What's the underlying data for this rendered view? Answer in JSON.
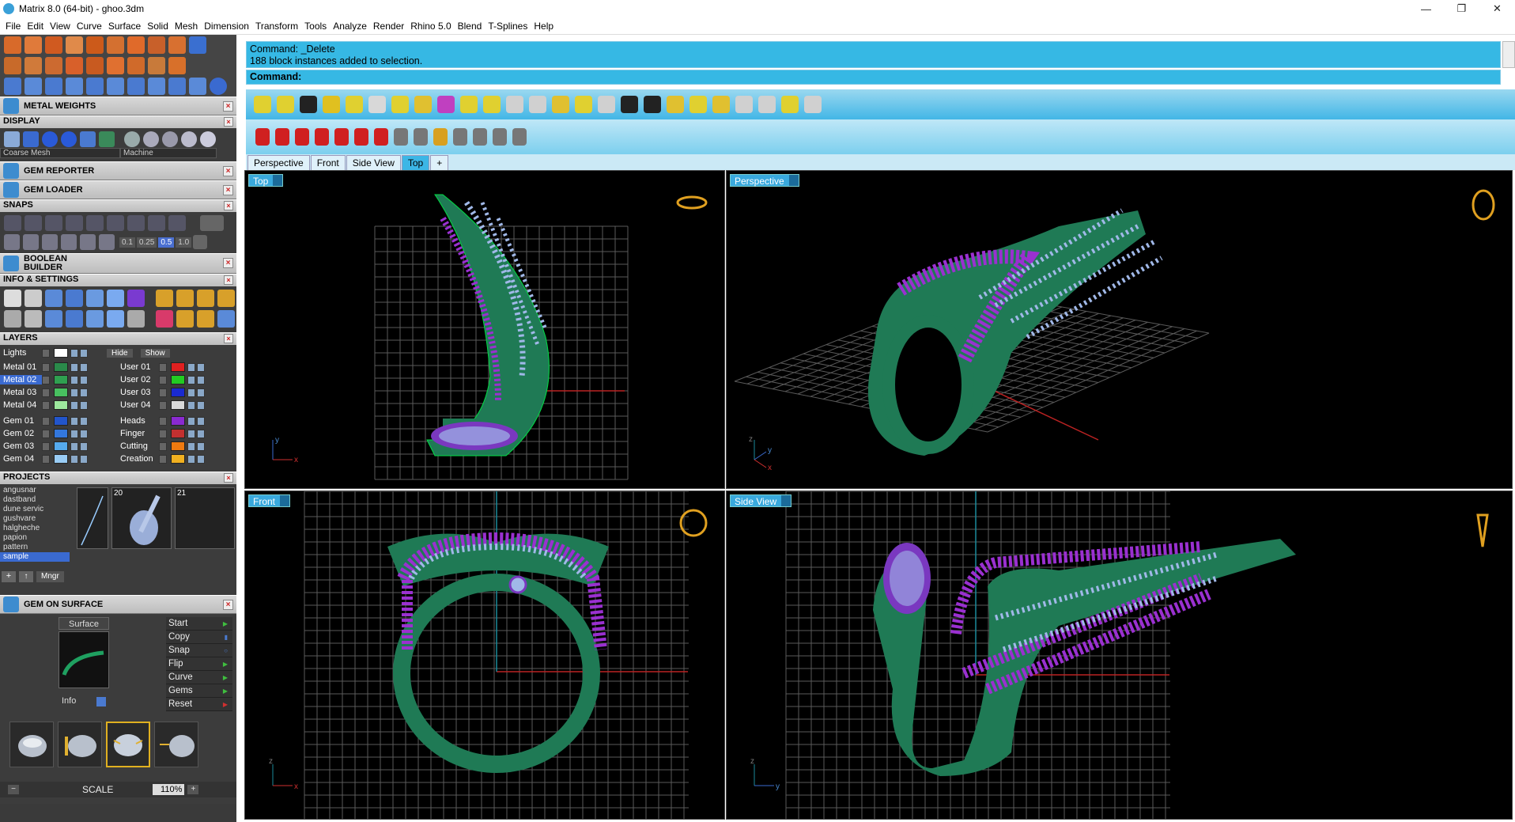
{
  "window": {
    "title": "Matrix 8.0 (64-bit) - ghoo.3dm",
    "buttons": [
      "—",
      "❐",
      "✕"
    ]
  },
  "menu": [
    "File",
    "Edit",
    "View",
    "Curve",
    "Surface",
    "Solid",
    "Mesh",
    "Dimension",
    "Transform",
    "Tools",
    "Analyze",
    "Render",
    "Rhino 5.0",
    "Blend",
    "T-Splines",
    "Help"
  ],
  "command": {
    "history_line1": "Command: _Delete",
    "history_line2": "188 block instances added to selection.",
    "prompt": "Command:"
  },
  "sidebar": {
    "metal_weights": "METAL WEIGHTS",
    "display": "DISPLAY",
    "display_mesh": "Coarse Mesh",
    "display_mode": "Machine",
    "gem_reporter": "GEM REPORTER",
    "gem_loader": "GEM LOADER",
    "snaps": "SNAPS",
    "snap_values": [
      "0.1",
      "0.25",
      "0.5",
      "1.0"
    ],
    "boolean_line1": "BOOLEAN",
    "boolean_line2": "BUILDER",
    "info_settings": "INFO & SETTINGS",
    "layers": "LAYERS",
    "layers_lights": "Lights",
    "layers_hide": "Hide",
    "layers_show": "Show",
    "layers_left": [
      {
        "name": "Metal 01",
        "color": "#2a8a4a"
      },
      {
        "name": "Metal 02",
        "color": "#2fa050"
      },
      {
        "name": "Metal 03",
        "color": "#48c060"
      },
      {
        "name": "Metal 04",
        "color": "#9de89d"
      },
      {
        "name": "Gem 01",
        "color": "#2255cc"
      },
      {
        "name": "Gem 02",
        "color": "#3377dd"
      },
      {
        "name": "Gem 03",
        "color": "#55aaee"
      },
      {
        "name": "Gem 04",
        "color": "#99ccf5"
      }
    ],
    "layers_right": [
      {
        "name": "User 01",
        "color": "#e02020"
      },
      {
        "name": "User 02",
        "color": "#22cc22"
      },
      {
        "name": "User 03",
        "color": "#1a2ad0"
      },
      {
        "name": "User 04",
        "color": "#d8d8d8"
      },
      {
        "name": "Heads",
        "color": "#8a2ad0"
      },
      {
        "name": "Finger",
        "color": "#c23030"
      },
      {
        "name": "Cutting",
        "color": "#ee7a10"
      },
      {
        "name": "Creation",
        "color": "#f0b020"
      }
    ],
    "projects": "PROJECTS",
    "project_list": [
      "angusnar",
      "dastband",
      "dune servic",
      "gushvare",
      "halgheche",
      "papion",
      "pattern",
      "sample"
    ],
    "project_thumb_numbers": [
      "20",
      "21"
    ],
    "projects_mngr": "Mngr",
    "gem_on_surface": "GEM ON SURFACE",
    "gos_surface_label": "Surface",
    "gos_info": "Info",
    "gos_buttons": [
      "Start",
      "Copy",
      "Snap",
      "Flip",
      "Curve",
      "Gems",
      "Reset"
    ],
    "scale_label": "SCALE",
    "scale_value": "110%"
  },
  "viewport_tabs": [
    "Perspective",
    "Front",
    "Side View",
    "Top",
    "+"
  ],
  "viewports": {
    "top": "Top",
    "perspective": "Perspective",
    "front": "Front",
    "side": "Side View"
  },
  "axes": {
    "x": "x",
    "y": "y",
    "z": "z"
  },
  "colors": {
    "accent": "#36b8e4",
    "metal": "#1f7a55",
    "gem_purple": "#9a30d0",
    "gem_light": "#a0b8e8",
    "grid": "#6a6a6a"
  }
}
